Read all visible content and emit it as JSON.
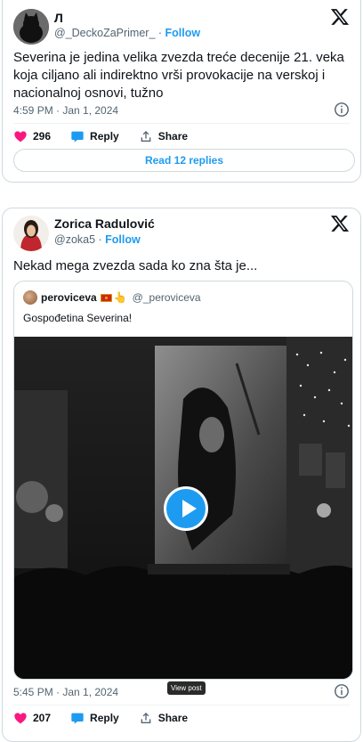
{
  "tweet1": {
    "name": "Л",
    "handle": "@_DeckoZaPrimer_",
    "follow": "Follow",
    "text": "Severina je jedina velika zvezda treće decenije 21. veka koja ciljano ali indirektno vrši provokacije na verskoj i nacionalnoj osnovi, tužno",
    "timestamp": "4:59 PM · Jan 1, 2024",
    "likes": "296",
    "reply_label": "Reply",
    "share_label": "Share",
    "read_replies": "Read 12 replies"
  },
  "tweet2": {
    "name": "Zorica Radulović",
    "handle": "@zoka5",
    "follow": "Follow",
    "text": "Nekad mega zvezda sada ko zna šta je...",
    "quote": {
      "name": "peroviceva",
      "emoji": "👆",
      "handle": "@_peroviceva",
      "text": "Gospođetina Severina!"
    },
    "tooltip": "View post",
    "timestamp": "5:45 PM · Jan 1, 2024",
    "likes": "207",
    "reply_label": "Reply",
    "share_label": "Share"
  },
  "colors": {
    "accent": "#1d9bf0",
    "like": "#f91880",
    "muted": "#536471"
  },
  "icons": [
    "x-logo-icon",
    "info-icon",
    "heart-icon",
    "reply-icon",
    "share-icon",
    "play-icon"
  ]
}
